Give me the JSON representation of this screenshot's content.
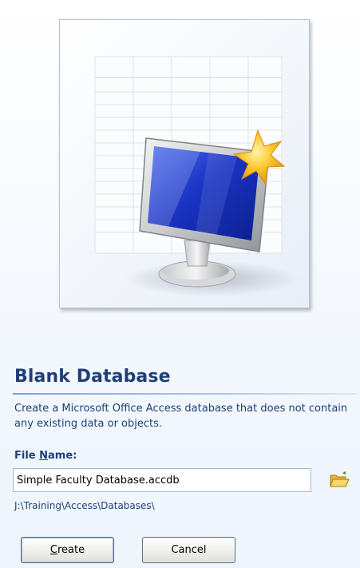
{
  "template": {
    "title": "Blank Database",
    "description": "Create a Microsoft Office Access database that does not contain any existing data or objects.",
    "preview_image": "blank-database-monitor-icon"
  },
  "file_name": {
    "label_before": "File ",
    "label_accel": "N",
    "label_after": "ame:",
    "value": "Simple Faculty Database.accdb",
    "browse_icon": "folder-open-icon"
  },
  "save_path": "J:\\Training\\Access\\Databases\\",
  "buttons": {
    "create_accel": "C",
    "create_rest": "reate",
    "cancel_label": "Cancel"
  },
  "colors": {
    "heading": "#1f3f78",
    "screen_blue": "#1838c8",
    "star": "#f7b51c"
  }
}
